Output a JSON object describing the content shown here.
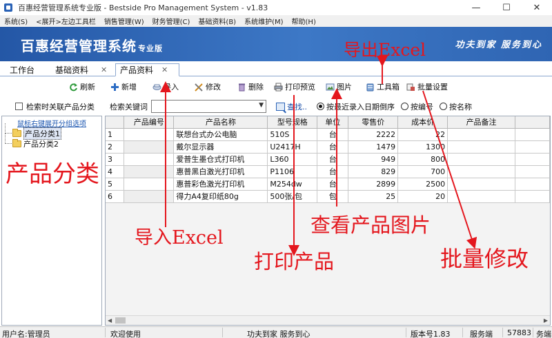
{
  "window": {
    "title": "百惠经营管理系统专业版 - Bestside Pro Management System - v1.83",
    "minimize": "—",
    "maximize": "☐",
    "close": "✕"
  },
  "menu": [
    "系统(S)",
    "<展开>左边工具栏",
    "销售管理(W)",
    "财务管理(C)",
    "基础资料(B)",
    "系统维护(M)",
    "帮助(H)"
  ],
  "banner": {
    "title": "百惠经营管理系统",
    "edition": "专业版",
    "slogan": "功夫到家 服务到心"
  },
  "tabs": [
    {
      "label": "工作台",
      "closable": false,
      "active": false
    },
    {
      "label": "基础资料",
      "closable": true,
      "active": false
    },
    {
      "label": "产品资料",
      "closable": true,
      "active": true
    }
  ],
  "toolbar": {
    "refresh": "刷新",
    "add": "新增",
    "import": "导入",
    "edit": "修改",
    "delete": "删除",
    "print_preview": "打印预览",
    "picture": "图片",
    "toolbox": "工具箱",
    "batch_settings": "批量设置"
  },
  "left": {
    "search_linked_label": "检索时关联产品分类",
    "hint": "鼠标右键展开分组选项",
    "tree": [
      {
        "label": "产品分类1",
        "selected": true
      },
      {
        "label": "产品分类2",
        "selected": false
      }
    ]
  },
  "search": {
    "label": "检索关键词",
    "value": "",
    "find": "查找..",
    "sort_options": [
      {
        "label": "按最近录入日期倒序",
        "selected": true
      },
      {
        "label": "按编号",
        "selected": false
      },
      {
        "label": "按名称",
        "selected": false
      }
    ]
  },
  "grid": {
    "columns": [
      "产品编号",
      "产品名称",
      "型号规格",
      "单位",
      "零售价",
      "成本价",
      "产品备注"
    ],
    "rows": [
      {
        "n": "1",
        "code": "",
        "name": "联想台式办公电脑",
        "model": "510S",
        "unit": "台",
        "retail": "2222",
        "cost": "22",
        "note": ""
      },
      {
        "n": "2",
        "code": "",
        "name": "戴尔显示器",
        "model": "U2417H",
        "unit": "台",
        "retail": "1479",
        "cost": "1300",
        "note": ""
      },
      {
        "n": "3",
        "code": "",
        "name": "爱普生墨仓式打印机",
        "model": "L360",
        "unit": "台",
        "retail": "949",
        "cost": "800",
        "note": ""
      },
      {
        "n": "4",
        "code": "",
        "name": "惠普黑白激光打印机",
        "model": "P1106",
        "unit": "台",
        "retail": "829",
        "cost": "700",
        "note": ""
      },
      {
        "n": "5",
        "code": "",
        "name": "惠普彩色激光打印机",
        "model": "M254dw",
        "unit": "台",
        "retail": "2899",
        "cost": "2500",
        "note": ""
      },
      {
        "n": "6",
        "code": "",
        "name": "得力A4复印纸80g",
        "model": "500张/包",
        "unit": "包",
        "retail": "25",
        "cost": "20",
        "note": ""
      }
    ]
  },
  "status": {
    "user": "用户名:管理员",
    "welcome": "欢迎使用",
    "slogan": "功夫到家 服务到心",
    "version": "版本号1.83",
    "server": "服务端",
    "count": "57883",
    "right_part": "务端"
  },
  "annotations": {
    "export_excel": "导出Excel",
    "product_category": "产品分类",
    "import_excel": "导入Excel",
    "view_picture": "查看产品图片",
    "print_product": "打印产品",
    "batch_edit": "批量修改",
    "color": "#e4161d"
  }
}
